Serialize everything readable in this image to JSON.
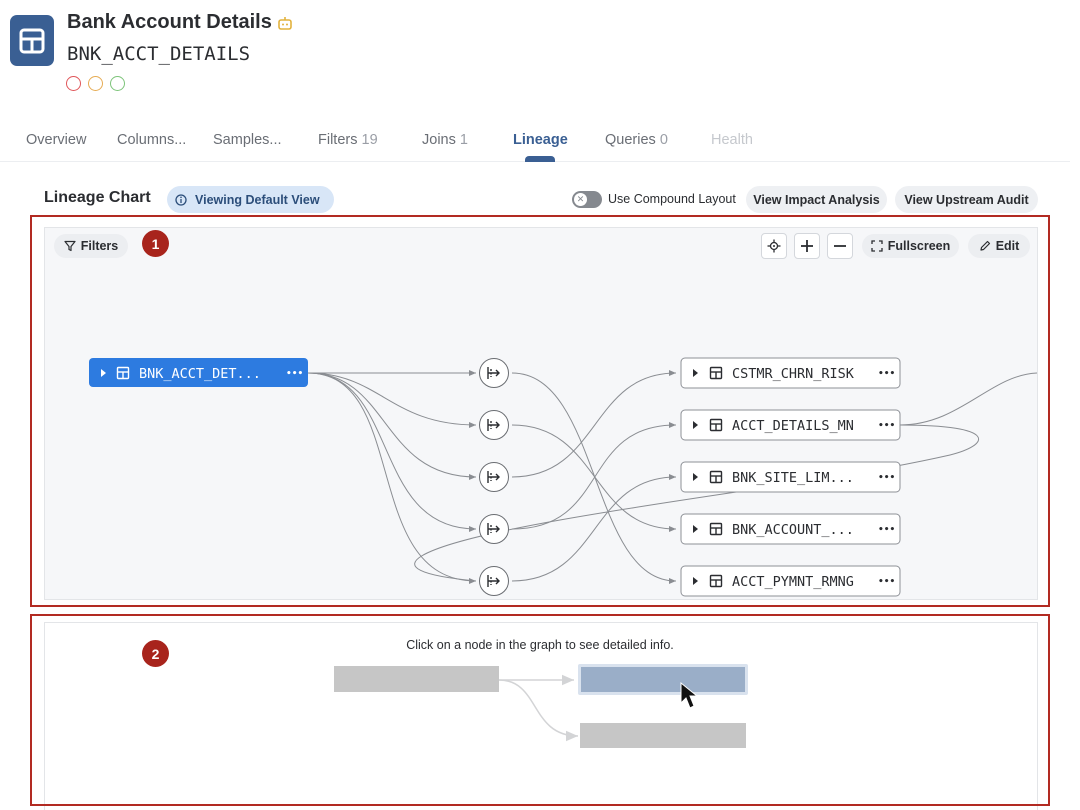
{
  "header": {
    "title": "Bank Account Details",
    "subtitle": "BNK_ACCT_DETAILS",
    "status_dot_colors": [
      "#e0565a",
      "#e6ac54",
      "#7dc47a"
    ],
    "bot_icon": "robot-icon"
  },
  "tabs": [
    {
      "label": "Overview",
      "count": "",
      "state": "normal"
    },
    {
      "label": "Columns...",
      "count": "",
      "state": "normal"
    },
    {
      "label": "Samples...",
      "count": "",
      "state": "normal"
    },
    {
      "label": "Filters",
      "count": "19",
      "state": "normal"
    },
    {
      "label": "Joins",
      "count": "1",
      "state": "normal"
    },
    {
      "label": "Lineage",
      "count": "",
      "state": "active"
    },
    {
      "label": "Queries",
      "count": "0",
      "state": "normal"
    },
    {
      "label": "Health",
      "count": "",
      "state": "disabled"
    }
  ],
  "lineage": {
    "heading": "Lineage Chart",
    "view_pill": "Viewing Default View",
    "compound_toggle_label": "Use Compound Layout",
    "compound_toggle_on": false,
    "impact_button": "View Impact Analysis",
    "upstream_button": "View Upstream Audit"
  },
  "canvas": {
    "filters_label": "Filters",
    "fullscreen_label": "Fullscreen",
    "edit_label": "Edit",
    "source_node": "BNK_ACCT_DET...",
    "target_nodes": [
      "CSTMR_CHRN_RISK",
      "ACCT_DETAILS_MN",
      "BNK_SITE_LIM...",
      "BNK_ACCOUNT_...",
      "ACCT_PYMNT_RMNG"
    ],
    "more_glyph": "•••"
  },
  "annotations": {
    "badge_1": "1",
    "badge_2": "2",
    "accent": "#b22a22"
  },
  "info_panel": {
    "hint": "Click on a node in the graph to see detailed info."
  },
  "colors": {
    "brand": "#3a5f93",
    "node_selected": "#2d7be0",
    "edge": "#8a8d92"
  }
}
